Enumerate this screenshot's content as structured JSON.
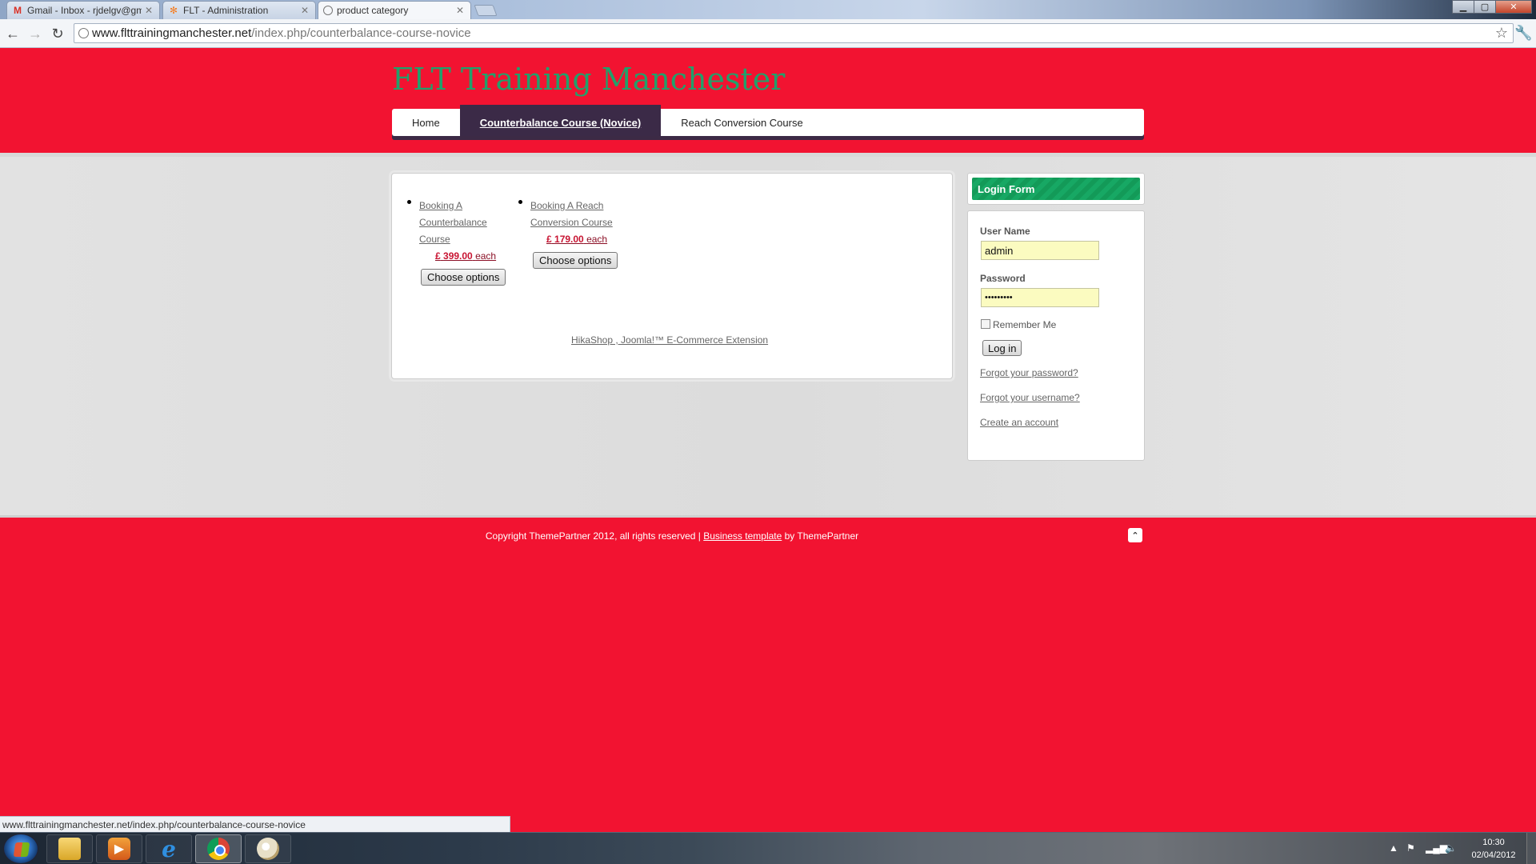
{
  "browser": {
    "tabs": [
      {
        "title": "Gmail - Inbox - rjdelgv@gm",
        "icon": "gmail-icon",
        "active": false
      },
      {
        "title": "FLT - Administration",
        "icon": "joomla-icon",
        "active": false
      },
      {
        "title": "product category",
        "icon": "page-icon",
        "active": true
      }
    ],
    "url_domain": "www.flttrainingmanchester.net",
    "url_path": "/index.php/counterbalance-course-novice",
    "status_text": "www.flttrainingmanchester.net/index.php/counterbalance-course-novice"
  },
  "site": {
    "logo": "FLT Training Manchester",
    "nav": [
      {
        "label": "Home",
        "active": false
      },
      {
        "label": "Counterbalance Course (Novice)",
        "active": true
      },
      {
        "label": "Reach Conversion Course",
        "active": false
      }
    ]
  },
  "products": [
    {
      "name_lines": [
        "Booking A",
        "Counterbalance",
        "Course "
      ],
      "currency": "£",
      "price": "399.00",
      "unit": "each",
      "button": "Choose options"
    },
    {
      "name_lines": [
        "Booking A Reach",
        "Conversion Course "
      ],
      "currency": "£",
      "price": "179.00",
      "unit": "each",
      "button": "Choose options"
    }
  ],
  "hikashop_link": "HikaShop , Joomla!™ E-Commerce Extension",
  "login": {
    "title": "Login Form",
    "username_label": "User Name",
    "username_value": "admin",
    "password_label": "Password",
    "password_value": "•••••••••",
    "remember_label": "Remember Me",
    "login_button": "Log in",
    "links": [
      "Forgot your password?",
      "Forgot your username?",
      "Create an account"
    ]
  },
  "footer": {
    "copyright_prefix": "Copyright ThemePartner 2012, all rights reserved | ",
    "template_link": "Business template",
    "copyright_suffix": " by ThemePartner"
  },
  "taskbar": {
    "apps": [
      "explorer-icon",
      "media-player-icon",
      "internet-explorer-icon",
      "chrome-icon",
      "paint-icon"
    ],
    "time": "10:30",
    "date": "02/04/2012"
  },
  "colors": {
    "page_red": "#f21331",
    "logo_green": "#22a06b",
    "nav_active": "#3b2a47",
    "login_header": "#139a58",
    "input_yellow": "#fbfbc0"
  }
}
